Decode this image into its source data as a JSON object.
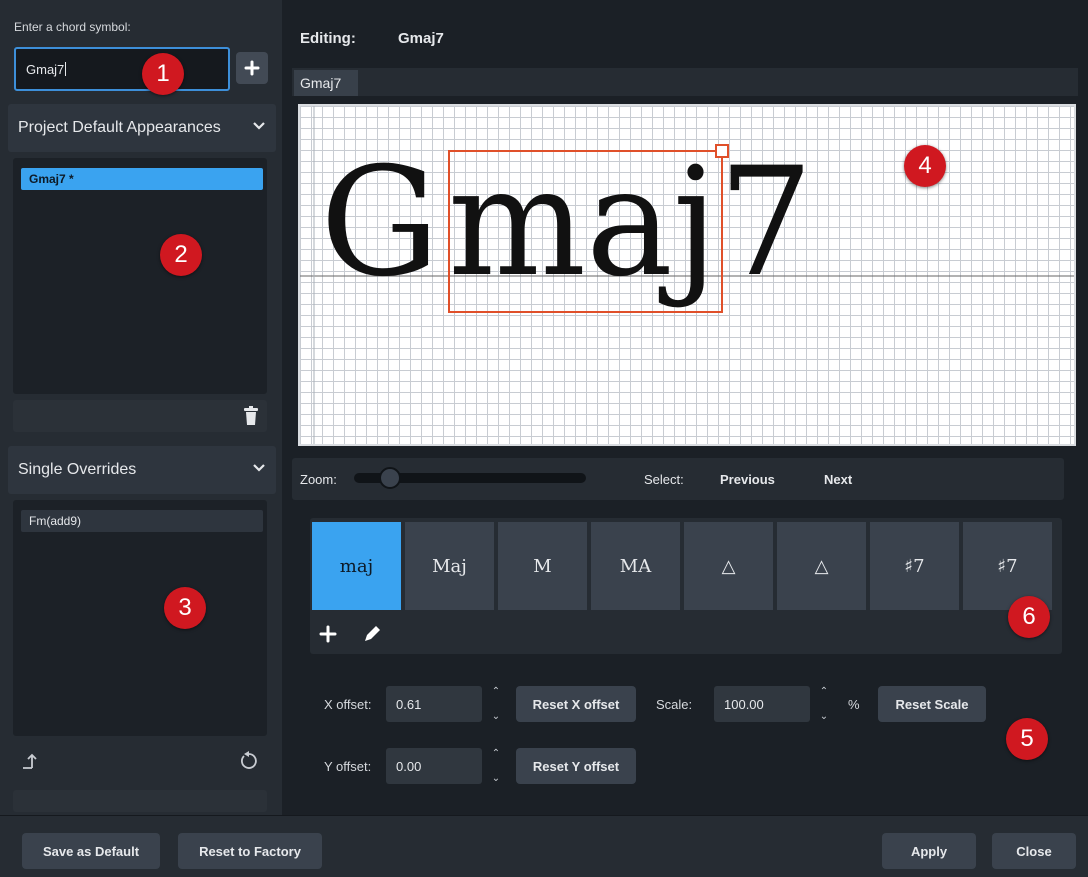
{
  "left": {
    "chord_prompt": "Enter a chord symbol:",
    "chord_value": "Gmaj7",
    "project_defaults_title": "Project Default Appearances",
    "project_items": [
      "Gmaj7 *"
    ],
    "single_overrides_title": "Single Overrides",
    "override_items": [
      "Fm(add9)"
    ]
  },
  "editor": {
    "editing_label": "Editing:",
    "editing_value": "Gmaj7",
    "tab_label": "Gmaj7",
    "preview_root": "G",
    "preview_suffix": "maj",
    "preview_ext": "7"
  },
  "zoom": {
    "zoom_label": "Zoom:",
    "zoom_level": 0.12,
    "select_label": "Select:",
    "previous_label": "Previous",
    "next_label": "Next"
  },
  "suffixes": [
    "maj",
    "Maj",
    "M",
    "MA",
    "△",
    "△",
    "♯7",
    "♯7"
  ],
  "suffix_selected_index": 0,
  "offsets": {
    "x_offset_label": "X offset:",
    "x_offset_value": "0.61",
    "reset_x_label": "Reset X offset",
    "scale_label": "Scale:",
    "scale_value": "100.00",
    "scale_unit": "%",
    "reset_scale_label": "Reset Scale",
    "y_offset_label": "Y offset:",
    "y_offset_value": "0.00",
    "reset_y_label": "Reset Y offset"
  },
  "footer": {
    "save_default_label": "Save as Default",
    "reset_factory_label": "Reset to Factory",
    "apply_label": "Apply",
    "close_label": "Close"
  },
  "callouts": [
    "1",
    "2",
    "3",
    "4",
    "5",
    "6"
  ],
  "colors": {
    "accent": "#3aa3f0",
    "callout": "#d01820",
    "selection_box": "#e0502a"
  }
}
